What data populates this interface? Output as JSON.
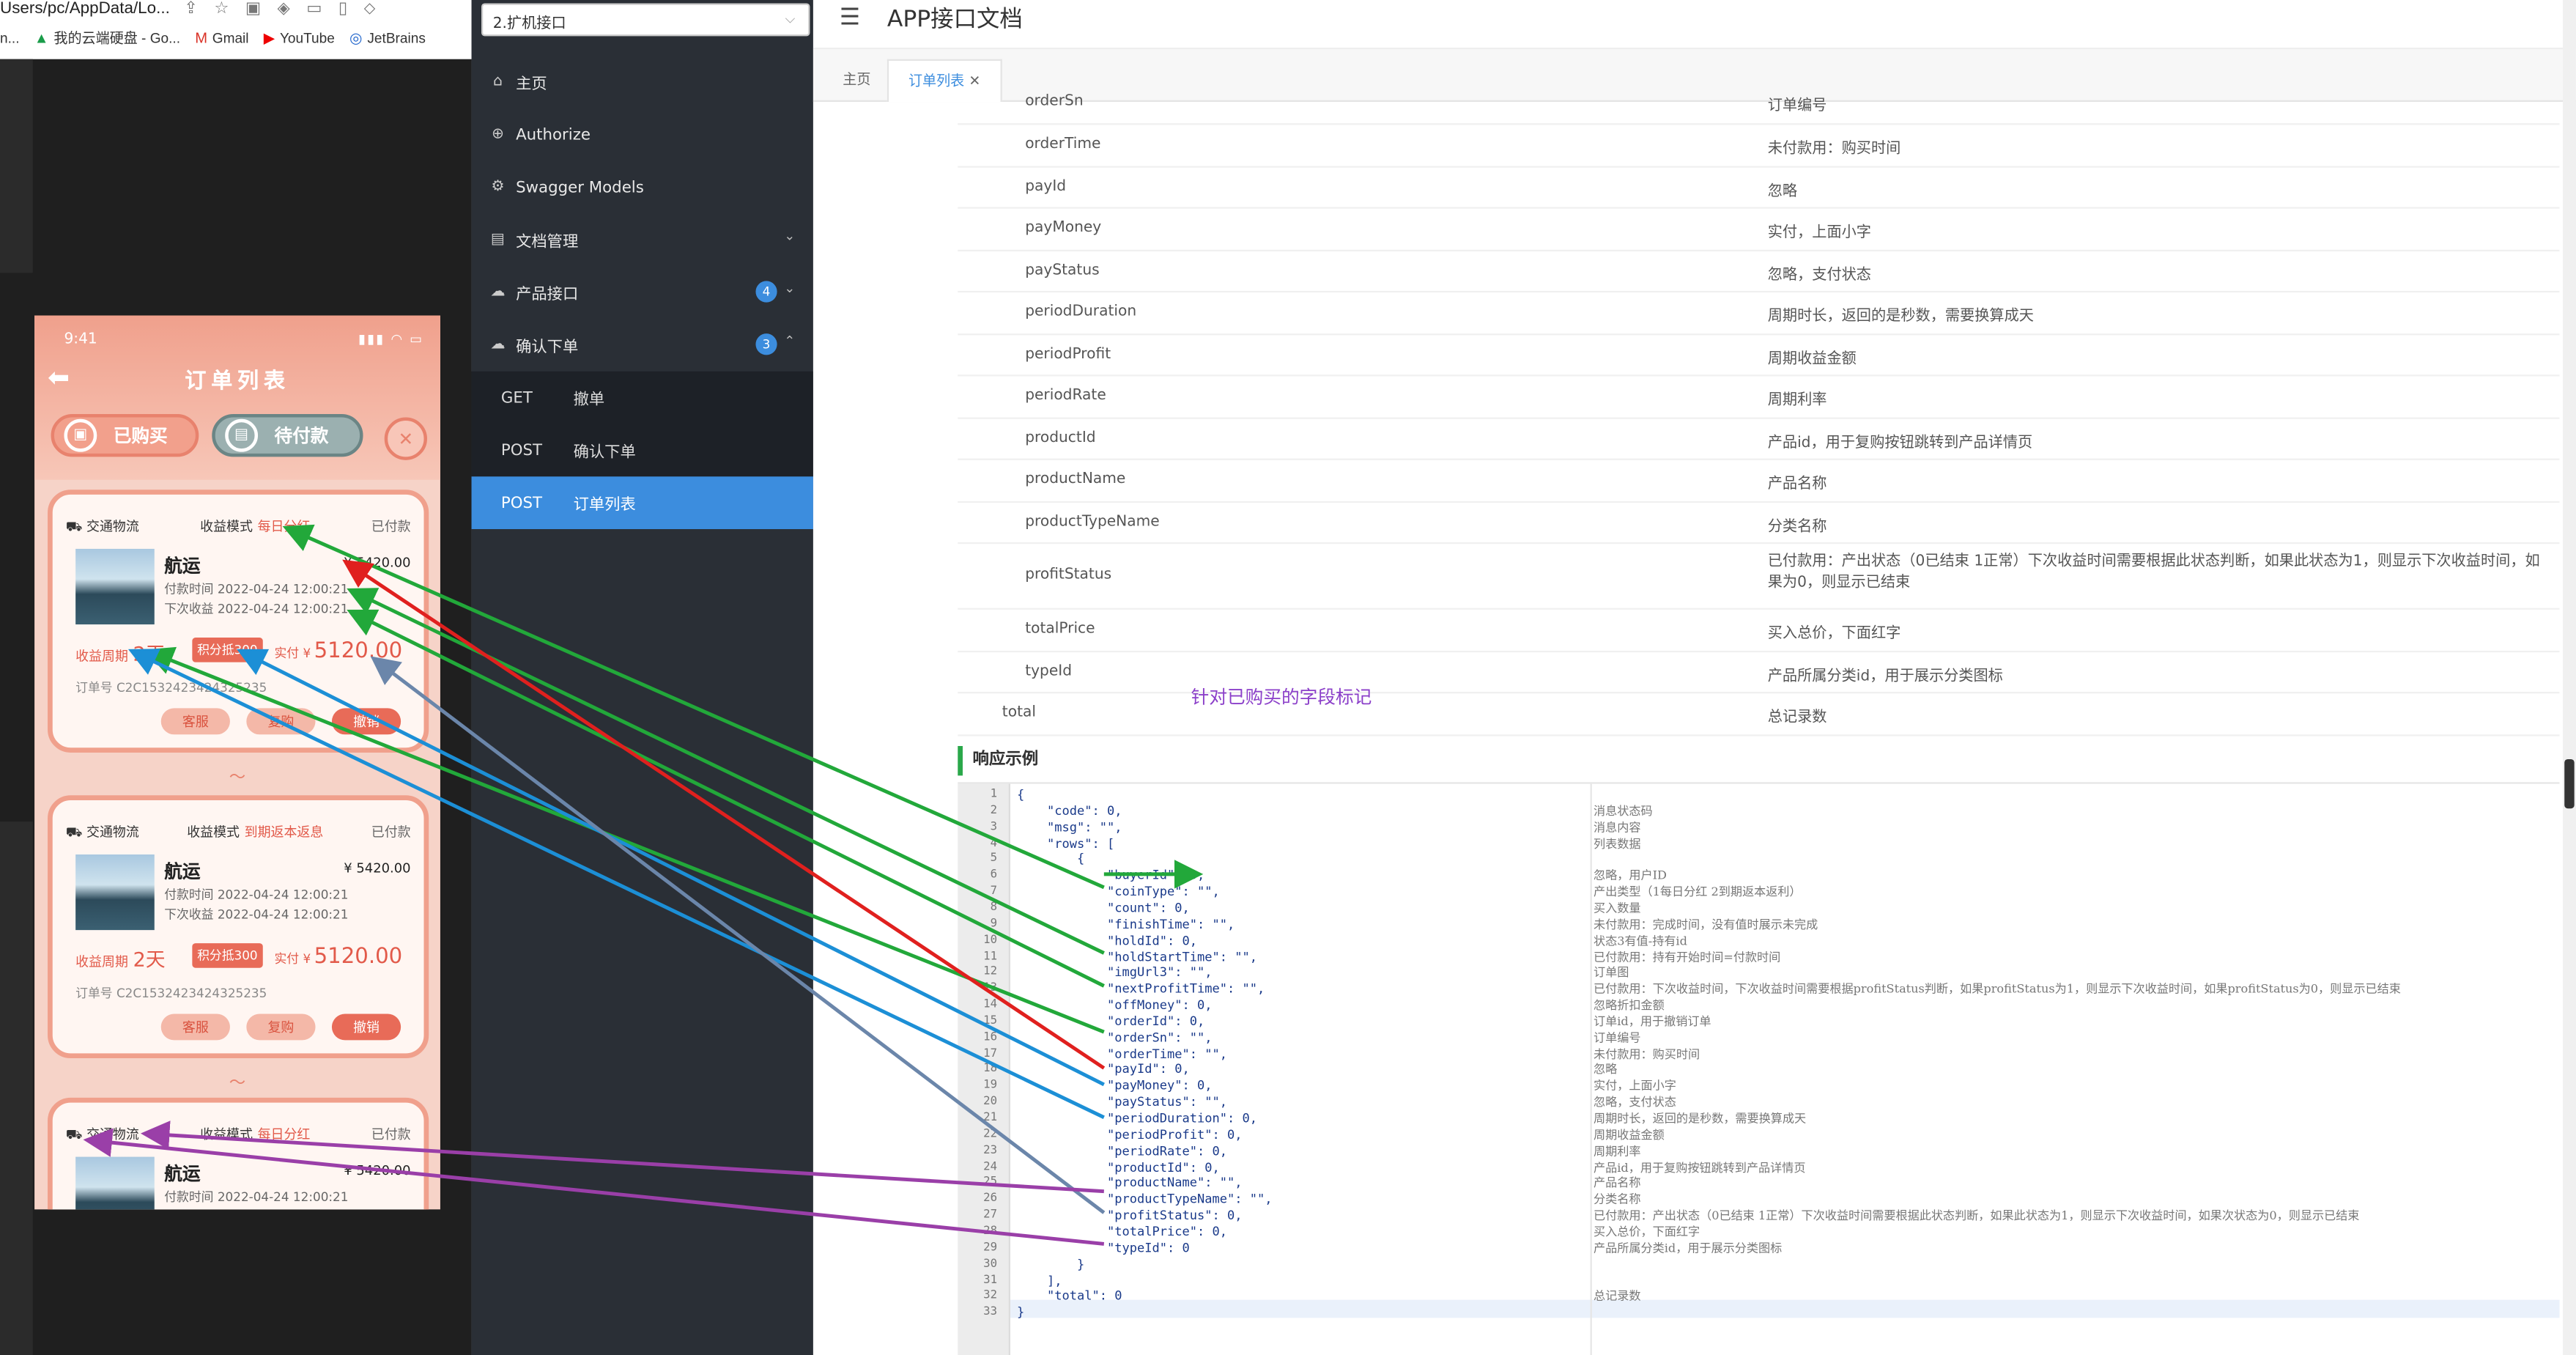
{
  "browser": {
    "url_fragment": "Users/pc/AppData/Lo...",
    "bookmark_cut": "n...",
    "bookmarks": [
      {
        "icon": "cloud-drive-icon",
        "label": "我的云端硬盘 - Go..."
      },
      {
        "icon": "gmail-icon",
        "label": "Gmail"
      },
      {
        "icon": "youtube-icon",
        "label": "YouTube"
      },
      {
        "icon": "jetbrains-icon",
        "label": "JetBrains"
      }
    ]
  },
  "phone": {
    "time": "9:41",
    "title": "订单列表",
    "tabs": [
      "已购买",
      "待付款"
    ],
    "cards": [
      {
        "category": "交通物流",
        "mode_label": "收益模式",
        "mode": "每日分红",
        "status": "已付款",
        "name": "航运",
        "price": "¥ 5420.00",
        "pay_time": "付款时间 2022-04-24 12:00:21",
        "next_profit": "下次收益 2022-04-24 12:00:21",
        "period_label": "收益周期",
        "period": "2天",
        "tag": "积分抵300",
        "paid_label": "实付 ¥",
        "paid": "5120.00",
        "order_no": "订单号 C2C1532423424325235",
        "btn1": "客服",
        "btn2": "复购",
        "btn3": "撤销"
      },
      {
        "category": "交通物流",
        "mode_label": "收益模式",
        "mode": "到期返本返息",
        "status": "已付款",
        "name": "航运",
        "price": "¥ 5420.00",
        "pay_time": "付款时间 2022-04-24 12:00:21",
        "next_profit": "下次收益 2022-04-24 12:00:21",
        "period_label": "收益周期",
        "period": "2天",
        "tag": "积分抵300",
        "paid_label": "实付 ¥",
        "paid": "5120.00",
        "order_no": "订单号 C2C1532423424325235",
        "btn1": "客服",
        "btn2": "复购",
        "btn3": "撤销"
      },
      {
        "category": "交通物流",
        "mode_label": "收益模式",
        "mode": "每日分红",
        "status": "已付款",
        "name": "航运",
        "price": "¥ 5420.00",
        "pay_time": "付款时间 2022-04-24 12:00:21"
      }
    ]
  },
  "sidebar": {
    "select_value": "2.扩机接口",
    "items": [
      {
        "icon": "home-icon",
        "label": "主页"
      },
      {
        "icon": "authorize-icon",
        "label": "Authorize"
      },
      {
        "icon": "models-icon",
        "label": "Swagger Models"
      },
      {
        "icon": "doc-manage-icon",
        "label": "文档管理"
      },
      {
        "icon": "cloud-icon",
        "label": "产品接口",
        "badge": "4"
      },
      {
        "icon": "cloud-icon",
        "label": "确认下单",
        "badge": "3"
      }
    ],
    "sub_items": [
      {
        "method": "GET",
        "label": "撤单"
      },
      {
        "method": "POST",
        "label": "确认下单"
      },
      {
        "method": "POST",
        "label": "订单列表"
      }
    ]
  },
  "main": {
    "title": "APP接口文档",
    "tabs": [
      "主页",
      "订单列表"
    ],
    "fields": [
      {
        "name": "orderSn",
        "desc": "订单编号"
      },
      {
        "name": "orderTime",
        "desc": "未付款用：购买时间"
      },
      {
        "name": "payId",
        "desc": "忽略"
      },
      {
        "name": "payMoney",
        "desc": "实付，上面小字"
      },
      {
        "name": "payStatus",
        "desc": "忽略，支付状态"
      },
      {
        "name": "periodDuration",
        "desc": "周期时长，返回的是秒数，需要换算成天"
      },
      {
        "name": "periodProfit",
        "desc": "周期收益金额"
      },
      {
        "name": "periodRate",
        "desc": "周期利率"
      },
      {
        "name": "productId",
        "desc": "产品id，用于复购按钮跳转到产品详情页"
      },
      {
        "name": "productName",
        "desc": "产品名称"
      },
      {
        "name": "productTypeName",
        "desc": "分类名称"
      },
      {
        "name": "profitStatus",
        "desc": "已付款用：产出状态（0已结束 1正常）下次收益时间需要根据此状态判断，如果此状态为1，则显示下次收益时间，如果为0，则显示已结束"
      },
      {
        "name": "totalPrice",
        "desc": "买入总价，下面红字"
      },
      {
        "name": "typeId",
        "desc": "产品所属分类id，用于展示分类图标"
      },
      {
        "name": "total",
        "desc": "总记录数"
      }
    ],
    "annotation": "针对已购买的字段标记",
    "response_title": "响应示例",
    "code_lines": [
      "{",
      "    \"code\": 0,",
      "    \"msg\": \"\",",
      "    \"rows\": [",
      "        {",
      "            \"buyerId\": 0,",
      "            \"coinType\": \"\",",
      "            \"count\": 0,",
      "            \"finishTime\": \"\",",
      "            \"holdId\": 0,",
      "            \"holdStartTime\": \"\",",
      "            \"imgUrl3\": \"\",",
      "            \"nextProfitTime\": \"\",",
      "            \"offMoney\": 0,",
      "            \"orderId\": 0,",
      "            \"orderSn\": \"\",",
      "            \"orderTime\": \"\",",
      "            \"payId\": 0,",
      "            \"payMoney\": 0,",
      "            \"payStatus\": \"\",",
      "            \"periodDuration\": 0,",
      "            \"periodProfit\": 0,",
      "            \"periodRate\": 0,",
      "            \"productId\": 0,",
      "            \"productName\": \"\",",
      "            \"productTypeName\": \"\",",
      "            \"profitStatus\": 0,",
      "            \"totalPrice\": 0,",
      "            \"typeId\": 0",
      "        }",
      "    ],",
      "    \"total\": 0",
      "}"
    ],
    "code_comments": [
      "",
      "消息状态码",
      "消息内容",
      "列表数据",
      "",
      "忽略，用户ID",
      "产出类型（1每日分红 2到期返本返利）",
      "买入数量",
      "未付款用：完成时间，没有值时展示未完成",
      "状态3有值-持有id",
      "已付款用：持有开始时间=付款时间",
      "订单图",
      "已付款用：下次收益时间，下次收益时间需要根据profitStatus判断，如果profitStatus为1，则显示下次收益时间，如果profitStatus为0，则显示已结束",
      "忽略折扣金额",
      "订单id，用于撤销订单",
      "订单编号",
      "未付款用：购买时间",
      "忽略",
      "实付，上面小字",
      "忽略，支付状态",
      "周期时长，返回的是秒数，需要换算成天",
      "周期收益金额",
      "周期利率",
      "产品id，用于复购按钮跳转到产品详情页",
      "产品名称",
      "分类名称",
      "已付款用：产出状态（0已结束 1正常）下次收益时间需要根据此状态判断，如果此状态为1，则显示下次收益时间，如果次状态为0，则显示已结束",
      "买入总价，下面红字",
      "产品所属分类id，用于展示分类图标",
      "",
      "",
      "总记录数",
      ""
    ]
  },
  "colors": {
    "sidebar_bg": "#2a2f36",
    "active_blue": "#3c8dde",
    "arrow_green": "#22a83a",
    "arrow_red": "#e0201e",
    "arrow_blue": "#1c8fd6",
    "arrow_slate": "#6b86aa",
    "arrow_purple": "#9a3fa8",
    "note_purple": "#8b3fc9"
  }
}
